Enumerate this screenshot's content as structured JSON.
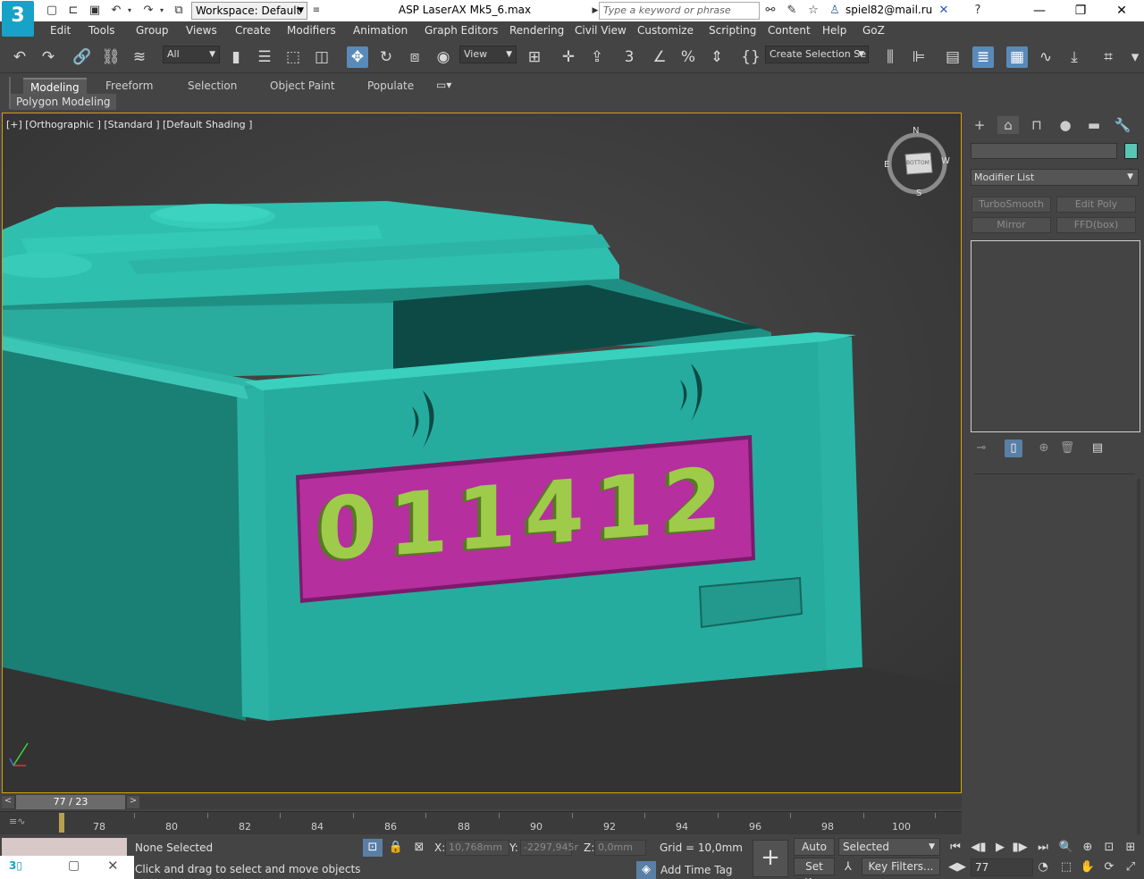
{
  "titlebar": {
    "app_logo": "3",
    "workspace": "Workspace: Default",
    "document_title": "ASP LaserAX Mk5_6.max",
    "search_placeholder": "Type a keyword or phrase",
    "user": "spiel82@mail.ru"
  },
  "menu": {
    "items": [
      "Edit",
      "Tools",
      "Group",
      "Views",
      "Create",
      "Modifiers",
      "Animation",
      "Graph Editors",
      "Rendering",
      "Civil View",
      "Customize",
      "Scripting",
      "Content",
      "Help",
      "GoZ"
    ]
  },
  "toolbar": {
    "selection_filter": "All",
    "reference_coord": "View",
    "named_selection": "Create Selection Se"
  },
  "ribbon": {
    "tabs": [
      "Modeling",
      "Freeform",
      "Selection",
      "Object Paint",
      "Populate"
    ],
    "active_tab": "Modeling",
    "panel_label": "Polygon Modeling"
  },
  "viewport": {
    "label": "[+] [Orthographic ] [Standard ] [Default Shading ]",
    "counter_digits": [
      "0",
      "1",
      "1",
      "4",
      "1",
      "2"
    ],
    "viewcube_labels": {
      "n": "N",
      "s": "S",
      "e": "W",
      "w": "E",
      "face": "BOTTOM"
    },
    "body_color": "#2aa89b",
    "panel_color": "#b52f9e",
    "digit_color": "#9ecb4a"
  },
  "command_panel": {
    "modifier_list": "Modifier List",
    "modifier_buttons": [
      "TurboSmooth",
      "Edit Poly",
      "Mirror",
      "FFD(box)"
    ]
  },
  "timeslider": {
    "position": "77 / 23",
    "prev": "<",
    "next": ">"
  },
  "trackbar": {
    "labels": [
      "78",
      "80",
      "82",
      "84",
      "86",
      "88",
      "90",
      "92",
      "94",
      "96",
      "98",
      "100"
    ]
  },
  "status": {
    "selection": "None Selected",
    "prompt": "Click and drag to select and move objects",
    "x_label": "X:",
    "x_value": "10,768mm",
    "y_label": "Y:",
    "y_value": "-2297,945r",
    "z_label": "Z:",
    "z_value": "0,0mm",
    "grid": "Grid = 10,0mm",
    "add_time_tag": "Add Time Tag",
    "auto_key": "Auto Key",
    "set_key": "Set Key",
    "key_mode": "Selected",
    "key_filters": "Key Filters...",
    "frame": "77"
  }
}
